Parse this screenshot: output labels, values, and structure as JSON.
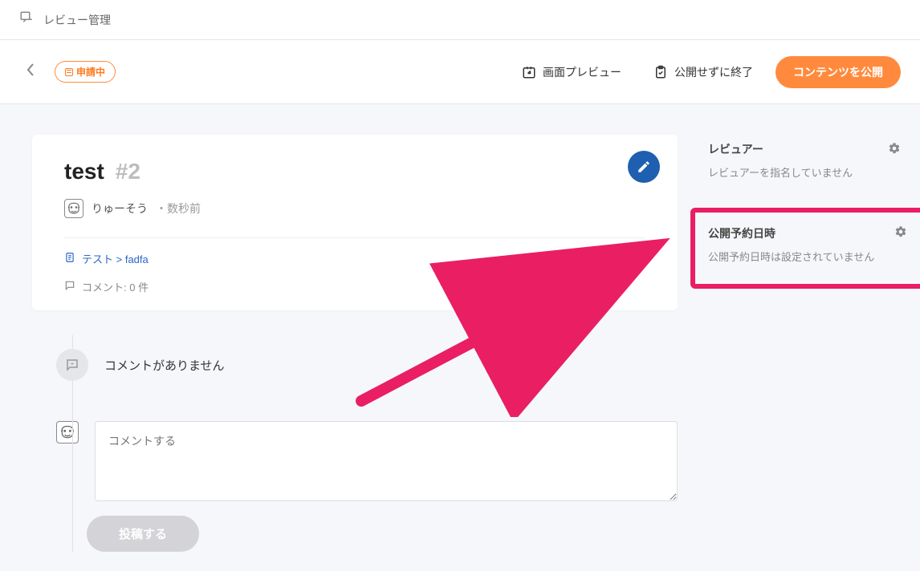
{
  "header": {
    "title": "レビュー管理"
  },
  "actions": {
    "status": "申請中",
    "preview": "画面プレビュー",
    "close_unpublished": "公開せずに終了",
    "publish": "コンテンツを公開"
  },
  "review": {
    "title": "test",
    "number": "#2",
    "author": "りゅーそう",
    "ago_prefix": "・",
    "ago": "数秒前",
    "breadcrumb_a": "テスト",
    "breadcrumb_sep": " > ",
    "breadcrumb_b": "fadfa",
    "comment_count_label": "コメント: 0 件"
  },
  "comments": {
    "empty": "コメントがありません",
    "placeholder": "コメントする",
    "submit": "投稿する"
  },
  "sidebar": {
    "reviewer_heading": "レビュアー",
    "reviewer_empty": "レビュアーを指名していません",
    "schedule_heading": "公開予約日時",
    "schedule_empty": "公開予約日時は設定されていません"
  }
}
